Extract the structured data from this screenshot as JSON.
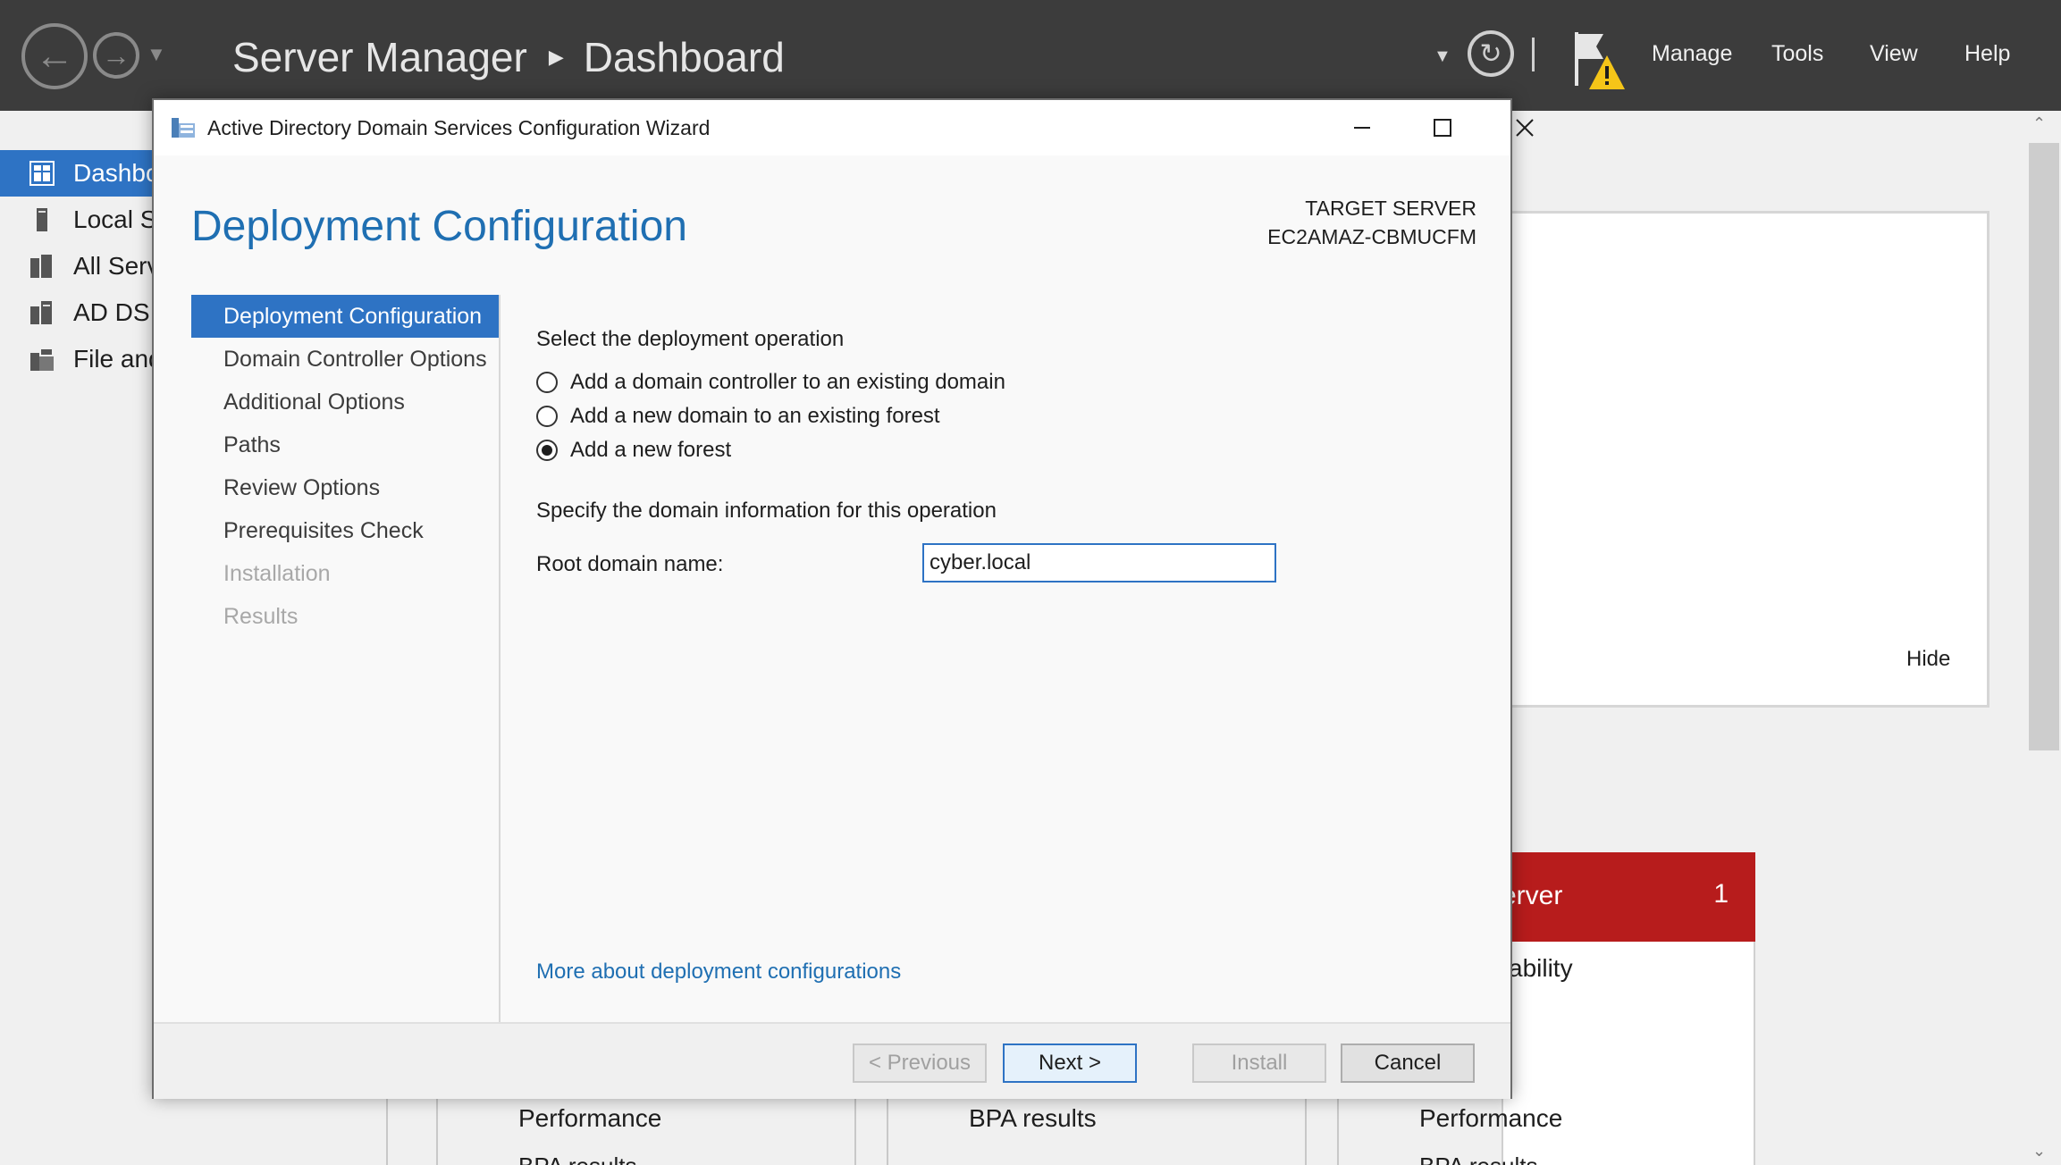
{
  "server_manager": {
    "breadcrumb": {
      "app": "Server Manager",
      "page": "Dashboard"
    },
    "menu": {
      "manage": "Manage",
      "tools": "Tools",
      "view": "View",
      "help": "Help"
    },
    "sidebar": {
      "items": [
        {
          "label": "Dashboard",
          "icon": "dashboard-icon",
          "active": true
        },
        {
          "label": "Local Server",
          "icon": "local-server-icon"
        },
        {
          "label": "All Servers",
          "icon": "all-servers-icon"
        },
        {
          "label": "AD DS",
          "icon": "ad-ds-icon"
        },
        {
          "label": "File and Storage Services",
          "icon": "file-storage-icon"
        }
      ]
    },
    "background": {
      "hide_link": "Hide",
      "card_title": "erver",
      "card_count": "1",
      "card_item": "ability",
      "columns": [
        {
          "label": "Performance",
          "sub": "BPA results"
        },
        {
          "label": "BPA results",
          "sub": ""
        },
        {
          "label": "Performance",
          "sub": "BPA results"
        }
      ]
    }
  },
  "wizard": {
    "title": "Active Directory Domain Services Configuration Wizard",
    "heading": "Deployment Configuration",
    "target_server_label": "TARGET SERVER",
    "target_server_name": "EC2AMAZ-CBMUCFM",
    "steps": [
      {
        "label": "Deployment Configuration",
        "state": "active"
      },
      {
        "label": "Domain Controller Options",
        "state": "normal"
      },
      {
        "label": "Additional Options",
        "state": "normal"
      },
      {
        "label": "Paths",
        "state": "normal"
      },
      {
        "label": "Review Options",
        "state": "normal"
      },
      {
        "label": "Prerequisites Check",
        "state": "normal"
      },
      {
        "label": "Installation",
        "state": "disabled"
      },
      {
        "label": "Results",
        "state": "disabled"
      }
    ],
    "operation_label": "Select the deployment operation",
    "options": [
      {
        "label": "Add a domain controller to an existing domain",
        "selected": false
      },
      {
        "label": "Add a new domain to an existing forest",
        "selected": false
      },
      {
        "label": "Add a new forest",
        "selected": true
      }
    ],
    "domain_info_label": "Specify the domain information for this operation",
    "root_domain_label": "Root domain name:",
    "root_domain_value": "cyber.local",
    "more_link": "More about deployment configurations",
    "buttons": {
      "previous": "< Previous",
      "next": "Next >",
      "install": "Install",
      "cancel": "Cancel"
    }
  },
  "colors": {
    "accent": "#2e73c4",
    "heading": "#1f6fb2",
    "titlebar": "#3c3c3c",
    "alert": "#b71c1c"
  }
}
